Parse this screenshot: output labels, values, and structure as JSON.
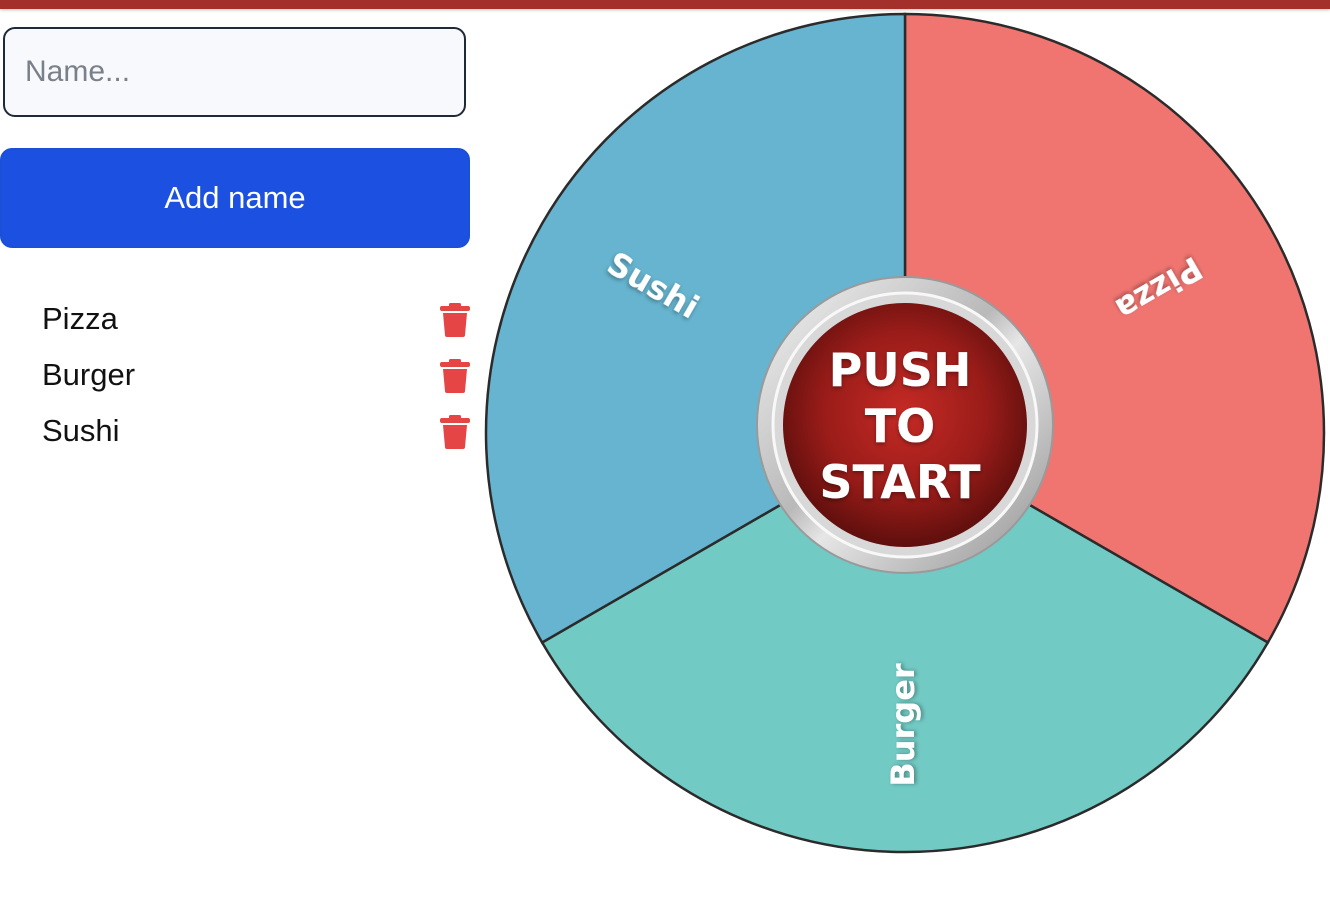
{
  "input": {
    "placeholder": "Name..."
  },
  "add_button": {
    "label": "Add name"
  },
  "names": [
    {
      "label": "Pizza"
    },
    {
      "label": "Burger"
    },
    {
      "label": "Sushi"
    }
  ],
  "wheel": {
    "segments": [
      {
        "label": "Pizza",
        "color": "#f07571"
      },
      {
        "label": "Burger",
        "color": "#72cac4"
      },
      {
        "label": "Sushi",
        "color": "#66b4cf"
      }
    ],
    "start_button": {
      "line1": "PUSH",
      "line2": "TO",
      "line3": "START"
    }
  },
  "colors": {
    "accent": "#1c50e0",
    "topbar": "#a3302b",
    "trash": "#e54545"
  }
}
